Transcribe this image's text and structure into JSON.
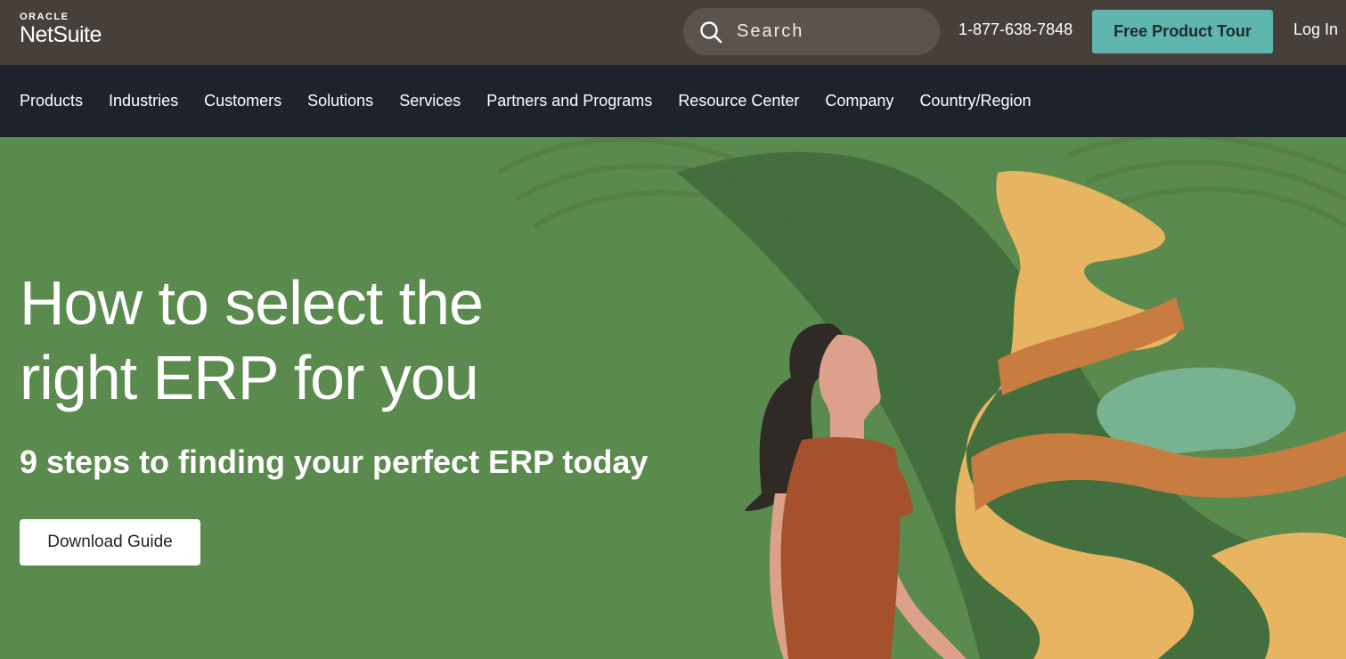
{
  "brand": {
    "parent": "ORACLE",
    "name": "NetSuite"
  },
  "header": {
    "search_placeholder": "Search",
    "phone": "1-877-638-7848",
    "tour_label": "Free Product Tour",
    "login_label": "Log In"
  },
  "nav": {
    "items": [
      {
        "label": "Products"
      },
      {
        "label": "Industries"
      },
      {
        "label": "Customers"
      },
      {
        "label": "Solutions"
      },
      {
        "label": "Services"
      },
      {
        "label": "Partners and Programs"
      },
      {
        "label": "Resource Center"
      },
      {
        "label": "Company"
      },
      {
        "label": "Country/Region"
      }
    ]
  },
  "hero": {
    "headline_line1": "How to select the",
    "headline_line2": "right ERP for you",
    "subhead": "9 steps to finding your perfect ERP today",
    "cta_label": "Download Guide"
  },
  "colors": {
    "topbar": "#463f3a",
    "nav": "#1e222b",
    "hero_green": "#5b8a4f",
    "accent_teal": "#5fb6ad"
  },
  "icons": {
    "search": "search-icon"
  }
}
